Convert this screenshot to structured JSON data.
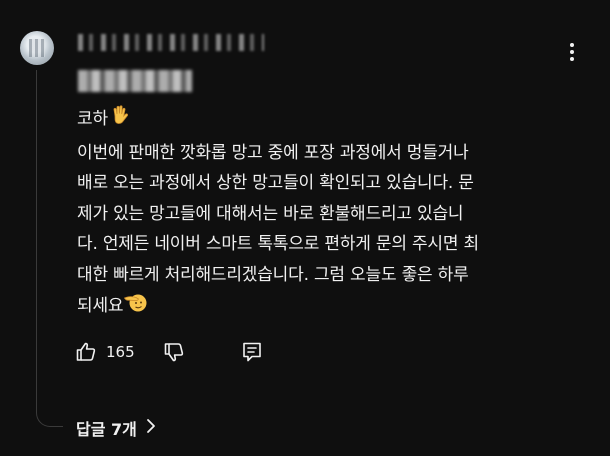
{
  "comment": {
    "author": "",
    "meta": "",
    "lines": [
      "코하",
      "이번에 판매한 깟화롭 망고 중에 포장 과정에서 멍들거나",
      "배로 오는 과정에서 상한 망고들이 확인되고 있습니다. 문",
      "제가 있는 망고들에 대해서는 바로 환불해드리고 있습니",
      "다. 언제든 네이버 스마트 톡톡으로 편하게 문의 주시면 최",
      "대한 빠르게 처리해드리겠습니다. 그럼 오늘도 좋은 하루",
      "되세요"
    ],
    "greeting_emoji": "waving-hand",
    "closing_emoji": "saluting-face",
    "like_count": "165",
    "replies_label": "답글 7개"
  },
  "colors": {
    "background": "#0f0f0f",
    "text": "#f1f1f1",
    "thread_line": "#3a3a3a"
  }
}
